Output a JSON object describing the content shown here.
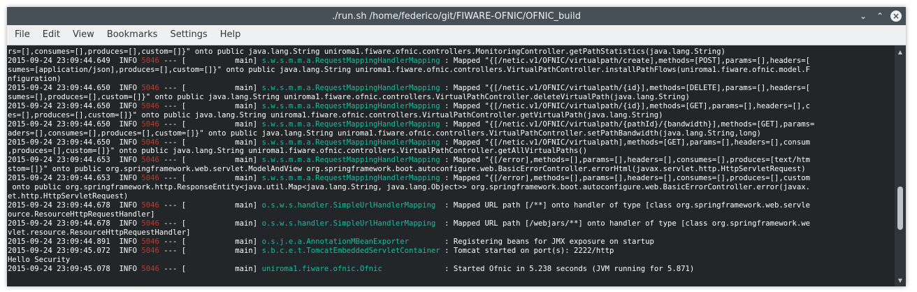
{
  "window": {
    "title": "./run.sh  /home/federico/git/FIWARE-OFNIC/OFNIC_build",
    "minimize_glyph": "⌄",
    "maximize_glyph": "⌃",
    "close_glyph": "×"
  },
  "menu": [
    {
      "label": "File"
    },
    {
      "label": "Edit"
    },
    {
      "label": "View"
    },
    {
      "label": "Bookmarks"
    },
    {
      "label": "Settings"
    },
    {
      "label": "Help"
    }
  ],
  "terminal": {
    "lines": [
      {
        "plain": "rs=[],consumes=[],produces=[],custom=[]}\" onto public java.lang.String uniroma1.fiware.ofnic.controllers.MonitoringController.getPathStatistics(java.lang.String)"
      },
      {
        "head": "2015-09-24 23:09:44.649  INFO ",
        "pid": "5046",
        "mid": " --- [           main] ",
        "logger": "s.w.s.m.m.a.RequestMappingHandlerMapping",
        "msg": " : Mapped \"{[/netic.v1/OFNIC/virtualpath/create],methods=[POST],params=[],headers=["
      },
      {
        "plain": "sumes=[application/json],produces=[],custom=[]}\" onto public java.lang.String uniroma1.fiware.ofnic.controllers.VirtualPathController.installPathFlows(uniroma1.fiware.ofnic.model.F"
      },
      {
        "plain": "nfiguration)"
      },
      {
        "head": "2015-09-24 23:09:44.650  INFO ",
        "pid": "5046",
        "mid": " --- [           main] ",
        "logger": "s.w.s.m.m.a.RequestMappingHandlerMapping",
        "msg": " : Mapped \"{[/netic.v1/OFNIC/virtualpath/{id}],methods=[DELETE],params=[],headers=["
      },
      {
        "plain": "sumes=[],produces=[],custom=[]}\" onto public java.lang.String uniroma1.fiware.ofnic.controllers.VirtualPathController.deleteVirtualPath(java.lang.String)"
      },
      {
        "head": "2015-09-24 23:09:44.650  INFO ",
        "pid": "5046",
        "mid": " --- [           main] ",
        "logger": "s.w.s.m.m.a.RequestMappingHandlerMapping",
        "msg": " : Mapped \"{[/netic.v1/OFNIC/virtualpath/{id}],methods=[GET],params=[],headers=[],c"
      },
      {
        "plain": "es=[],produces=[],custom=[]}\" onto public java.lang.String uniroma1.fiware.ofnic.controllers.VirtualPathController.getVirtualPath(java.lang.String)"
      },
      {
        "head": "2015-09-24 23:09:44.650  INFO ",
        "pid": "5046",
        "mid": " --- [           main] ",
        "logger": "s.w.s.m.m.a.RequestMappingHandlerMapping",
        "msg": " : Mapped \"{[/netic.v1/OFNIC/virtualpath/{pathId}/{bandwidth}],methods=[GET],params="
      },
      {
        "plain": "aders=[],consumes=[],produces=[],custom=[]}\" onto public java.lang.String uniroma1.fiware.ofnic.controllers.VirtualPathController.setPathBandwidth(java.lang.String,long)"
      },
      {
        "head": "2015-09-24 23:09:44.650  INFO ",
        "pid": "5046",
        "mid": " --- [           main] ",
        "logger": "s.w.s.m.m.a.RequestMappingHandlerMapping",
        "msg": " : Mapped \"{[/netic.v1/OFNIC/virtualpath],methods=[GET],params=[],headers=[],consum"
      },
      {
        "plain": ",produces=[],custom=[]}\" onto public java.lang.String uniroma1.fiware.ofnic.controllers.VirtualPathController.getAllVirtualPaths()"
      },
      {
        "head": "2015-09-24 23:09:44.653  INFO ",
        "pid": "5046",
        "mid": " --- [           main] ",
        "logger": "s.w.s.m.m.a.RequestMappingHandlerMapping",
        "msg": " : Mapped \"{[/error],methods=[],params=[],headers=[],consumes=[],produces=[text/htm"
      },
      {
        "plain": "stom=[]}\" onto public org.springframework.web.servlet.ModelAndView org.springframework.boot.autoconfigure.web.BasicErrorController.errorHtml(javax.servlet.http.HttpServletRequest)"
      },
      {
        "head": "2015-09-24 23:09:44.653  INFO ",
        "pid": "5046",
        "mid": " --- [           main] ",
        "logger": "s.w.s.m.m.a.RequestMappingHandlerMapping",
        "msg": " : Mapped \"{[/error],methods=[],params=[],headers=[],consumes=[],produces=[],custom"
      },
      {
        "plain": " onto public org.springframework.http.ResponseEntity<java.util.Map<java.lang.String, java.lang.Object>> org.springframework.boot.autoconfigure.web.BasicErrorController.error(javax."
      },
      {
        "plain": "et.http.HttpServletRequest)"
      },
      {
        "head": "2015-09-24 23:09:44.678  INFO ",
        "pid": "5046",
        "mid": " --- [           main] ",
        "logger": "o.s.w.s.handler.SimpleUrlHandlerMapping ",
        "msg": " : Mapped URL path [/**] onto handler of type [class org.springframework.web.servle"
      },
      {
        "plain": "ource.ResourceHttpRequestHandler]"
      },
      {
        "head": "2015-09-24 23:09:44.678  INFO ",
        "pid": "5046",
        "mid": " --- [           main] ",
        "logger": "o.s.w.s.handler.SimpleUrlHandlerMapping ",
        "msg": " : Mapped URL path [/webjars/**] onto handler of type [class org.springframework.we"
      },
      {
        "plain": "vlet.resource.ResourceHttpRequestHandler]"
      },
      {
        "head": "2015-09-24 23:09:44.891  INFO ",
        "pid": "5046",
        "mid": " --- [           main] ",
        "logger": "o.s.j.e.a.AnnotationMBeanExporter       ",
        "msg": " : Registering beans for JMX exposure on startup"
      },
      {
        "head": "2015-09-24 23:09:45.072  INFO ",
        "pid": "5046",
        "mid": " --- [           main] ",
        "logger": "s.b.c.e.t.TomcatEmbeddedServletContainer",
        "msg": " : Tomcat started on port(s): 2222/http"
      },
      {
        "plain": "Hello Security"
      },
      {
        "head": "2015-09-24 23:09:45.078  INFO ",
        "pid": "5046",
        "mid": " --- [           main] ",
        "logger": "uniroma1.fiware.ofnic.Ofnic             ",
        "msg": " : Started Ofnic in 5.238 seconds (JVM running for 5.871)"
      }
    ]
  },
  "colors": {
    "terminal_bg": "#232629",
    "pid": "#c0392b",
    "logger": "#1abc9c"
  }
}
